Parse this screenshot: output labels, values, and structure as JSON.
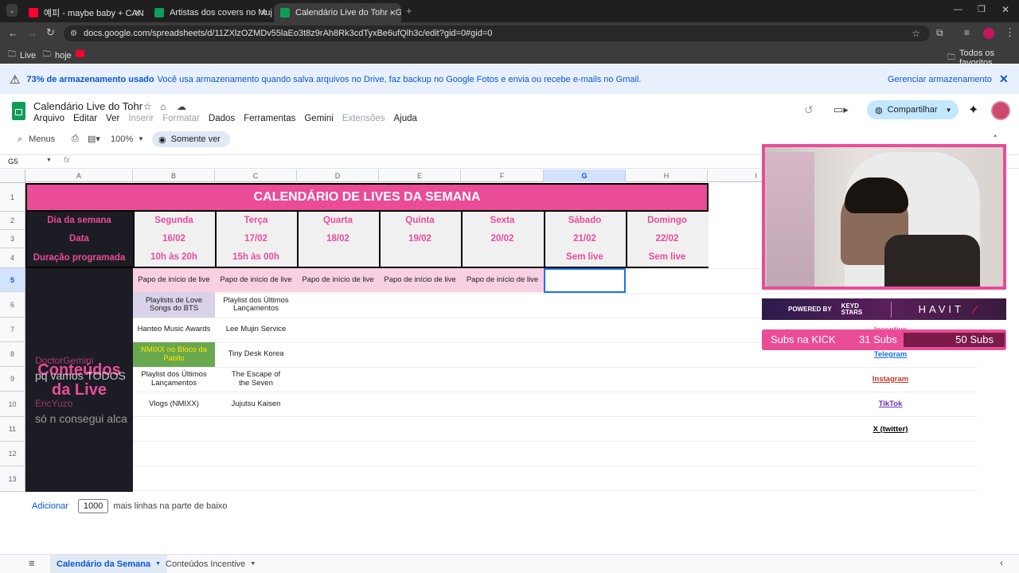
{
  "browser": {
    "tabs": [
      {
        "title": "예피 - maybe baby + CAN I SIP",
        "icon_color": "#ff0033"
      },
      {
        "title": "Artistas dos covers no Mujin - G",
        "icon_color": "#0f9d58"
      },
      {
        "title": "Calendário Live do Tohr - Goog",
        "icon_color": "#0f9d58"
      }
    ],
    "url": "docs.google.com/spreadsheets/d/11ZXlzOZMDv55laEo3t8z9rAh8Rk3cdTyxBe6ufQlh3c/edit?gid=0#gid=0",
    "bookmarks": [
      "Live",
      "hoje"
    ],
    "favorites_label": "Todos os favoritos"
  },
  "notice": {
    "bold": "73% de armazenamento usado",
    "text": "Você usa armazenamento quando salva arquivos no Drive, faz backup no Google Fotos e envia ou recebe e-mails no Gmail.",
    "manage": "Gerenciar armazenamento"
  },
  "doc": {
    "title": "Calendário Live do Tohr",
    "menus": [
      {
        "label": "Arquivo",
        "disabled": false
      },
      {
        "label": "Editar",
        "disabled": false
      },
      {
        "label": "Ver",
        "disabled": false
      },
      {
        "label": "Inserir",
        "disabled": true
      },
      {
        "label": "Formatar",
        "disabled": true
      },
      {
        "label": "Dados",
        "disabled": false
      },
      {
        "label": "Ferramentas",
        "disabled": false
      },
      {
        "label": "Gemini",
        "disabled": false
      },
      {
        "label": "Extensões",
        "disabled": true
      },
      {
        "label": "Ajuda",
        "disabled": false
      }
    ],
    "share": "Compartilhar",
    "search": "Menus",
    "zoom": "100%",
    "view_mode": "Somente ver",
    "cell_ref": "G5"
  },
  "sheet": {
    "columns": [
      "A",
      "B",
      "C",
      "D",
      "E",
      "F",
      "G",
      "H",
      "I"
    ],
    "rows": [
      "1",
      "2",
      "3",
      "4",
      "5",
      "6",
      "7",
      "8",
      "9",
      "10",
      "11",
      "12",
      "13"
    ],
    "banner": "CALENDÁRIO DE LIVES DA SEMANA",
    "labels": {
      "day": "Dia da semana",
      "date": "Data",
      "duration": "Duração programada"
    },
    "days": [
      {
        "name": "Segunda",
        "date": "16/02",
        "duration": "10h às 20h"
      },
      {
        "name": "Terça",
        "date": "17/02",
        "duration": "15h às 00h"
      },
      {
        "name": "Quarta",
        "date": "18/02",
        "duration": ""
      },
      {
        "name": "Quinta",
        "date": "19/02",
        "duration": ""
      },
      {
        "name": "Sexta",
        "date": "20/02",
        "duration": ""
      },
      {
        "name": "Sábado",
        "date": "21/02",
        "duration": "Sem live"
      },
      {
        "name": "Domingo",
        "date": "22/02",
        "duration": "Sem live"
      }
    ],
    "papo": "Papo de início de live",
    "content_label": "Conteúdos da Live",
    "col_b": [
      "Playlists de Love Songs do BTS",
      "Hanteo Music Awards",
      "NMIXX no Bloco da Pabllo",
      "Playlist dos Últimos Lançamentos",
      "Vlogs (NMIXX)"
    ],
    "col_c": [
      "Playlist dos Últimos Lançamentos",
      "Lee Mujin Service",
      "Tiny Desk Korea",
      "The Escape of the Seven",
      "Jujutsu Kaisen"
    ],
    "links": [
      {
        "label": "Incentive",
        "color": "#ea4c98"
      },
      {
        "label": "Telegram",
        "color": "#1a73e8"
      },
      {
        "label": "Instagram",
        "color": "#c0392b"
      },
      {
        "label": "TikTok",
        "color": "#6f2dbd"
      },
      {
        "label": "X (twitter)",
        "color": "#000000"
      }
    ],
    "add": {
      "button": "Adicionar",
      "count": "1000",
      "suffix": "mais linhas na parte de baixo"
    }
  },
  "sheet_tabs": [
    "Calendário da Semana",
    "Conteúdos Incentive"
  ],
  "chat": [
    {
      "user": "DoctorGemini",
      "msg": "pq vamos TODOS"
    },
    {
      "user": "EricYuzo",
      "msg": "só n consegui alca"
    }
  ],
  "stream": {
    "powered_by": "POWERED BY",
    "sponsor1": "KEYD STARS",
    "sponsor2": "HAVIT",
    "kick_label": "Subs na KICK",
    "subs_current": "31 Subs",
    "subs_goal": "50 Subs",
    "progress": 0.62
  },
  "colors": {
    "pink": "#ea4c98",
    "dark": "#1c1c24",
    "green": "#6aa84f",
    "papo": "#f8d0e2",
    "lavender": "#d9d2e9"
  }
}
